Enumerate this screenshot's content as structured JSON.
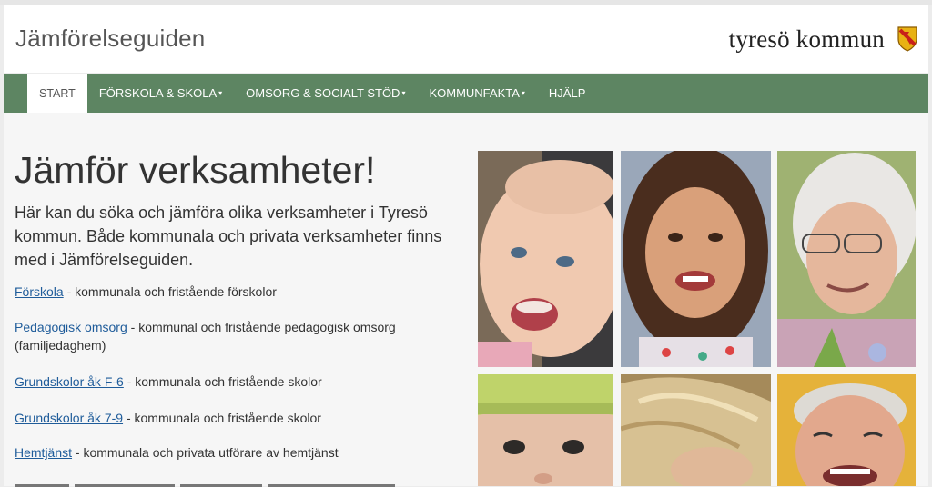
{
  "header": {
    "site_title": "Jämförelseguiden",
    "logo_text": "tyresö kommun"
  },
  "nav": {
    "items": [
      {
        "label": "START",
        "active": true,
        "dropdown": false
      },
      {
        "label": "FÖRSKOLA & SKOLA",
        "active": false,
        "dropdown": true
      },
      {
        "label": "OMSORG & SOCIALT STÖD",
        "active": false,
        "dropdown": true
      },
      {
        "label": "KOMMUNFAKTA",
        "active": false,
        "dropdown": true
      },
      {
        "label": "HJÄLP",
        "active": false,
        "dropdown": false
      }
    ],
    "caret": "▾"
  },
  "main": {
    "title": "Jämför verksamheter!",
    "intro": "Här kan du söka och jämföra olika verksamheter i Tyresö kommun. Både kommunala och privata verksamheter finns med i Jämförelseguiden.",
    "links": [
      {
        "link": "Förskola",
        "desc": " -  kommunala och fristående förskolor"
      },
      {
        "link": "Pedagogisk omsorg",
        "desc": " - kommunal och fristående pedagogisk omsorg (familjedaghem)"
      },
      {
        "link": "Grundskolor åk F-6",
        "desc": " - kommunala och fristående skolor"
      },
      {
        "link": "Grundskolor åk 7-9",
        "desc": " - kommunala och fristående skolor"
      },
      {
        "link": "Hemtjänst",
        "desc": " - kommunala och privata utförare av hemtjänst"
      }
    ]
  },
  "colors": {
    "nav_bg": "#5d8562",
    "link": "#1f5c9a"
  },
  "icons": [
    "coat-of-arms-icon",
    "caret-down-icon"
  ]
}
